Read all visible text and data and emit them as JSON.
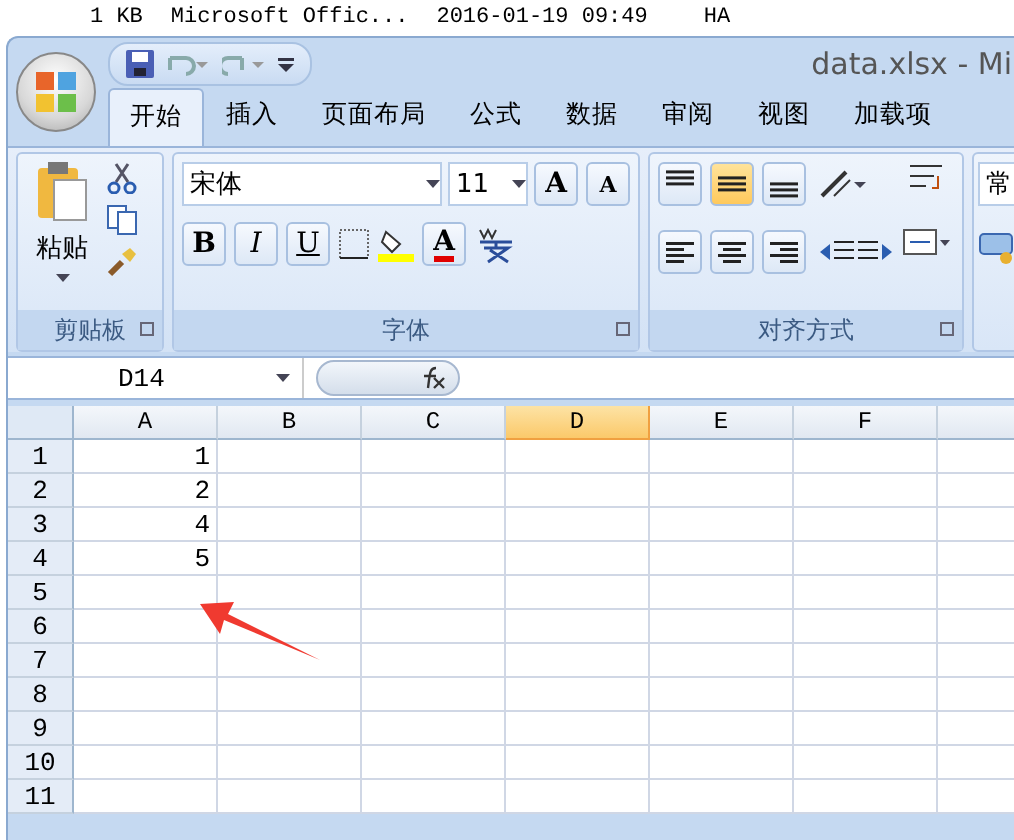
{
  "file_info": {
    "size": "1 KB",
    "type": "Microsoft Offic...",
    "modified": "2016-01-19 09:49",
    "attributes": "HA"
  },
  "window": {
    "title": "data.xlsx - Mi"
  },
  "tabs": [
    {
      "label": "开始",
      "selected": true
    },
    {
      "label": "插入",
      "selected": false
    },
    {
      "label": "页面布局",
      "selected": false
    },
    {
      "label": "公式",
      "selected": false
    },
    {
      "label": "数据",
      "selected": false
    },
    {
      "label": "审阅",
      "selected": false
    },
    {
      "label": "视图",
      "selected": false
    },
    {
      "label": "加载项",
      "selected": false
    }
  ],
  "ribbon": {
    "clipboard": {
      "paste": "粘贴",
      "label": "剪贴板"
    },
    "font": {
      "name": "宋体",
      "size": "11",
      "bold": "B",
      "italic": "I",
      "underline": "U",
      "grow": "A",
      "shrink": "A",
      "color_button": "A",
      "label": "字体"
    },
    "alignment": {
      "vertical": [
        {
          "kind": "top",
          "selected": false
        },
        {
          "kind": "middle",
          "selected": true
        },
        {
          "kind": "bottom",
          "selected": false
        }
      ],
      "label": "对齐方式"
    },
    "number": {
      "format": "常"
    }
  },
  "name_box": "D14",
  "columns": [
    {
      "label": "A",
      "selected": false
    },
    {
      "label": "B",
      "selected": false
    },
    {
      "label": "C",
      "selected": false
    },
    {
      "label": "D",
      "selected": true
    },
    {
      "label": "E",
      "selected": false
    },
    {
      "label": "F",
      "selected": false
    }
  ],
  "rows": [
    {
      "number": "1",
      "cells": [
        "1"
      ]
    },
    {
      "number": "2",
      "cells": [
        "2"
      ]
    },
    {
      "number": "3",
      "cells": [
        "4"
      ]
    },
    {
      "number": "4",
      "cells": [
        "5"
      ]
    },
    {
      "number": "5",
      "cells": []
    },
    {
      "number": "6",
      "cells": []
    },
    {
      "number": "7",
      "cells": []
    },
    {
      "number": "8",
      "cells": []
    },
    {
      "number": "9",
      "cells": []
    },
    {
      "number": "10",
      "cells": []
    },
    {
      "number": "11",
      "cells": []
    }
  ]
}
